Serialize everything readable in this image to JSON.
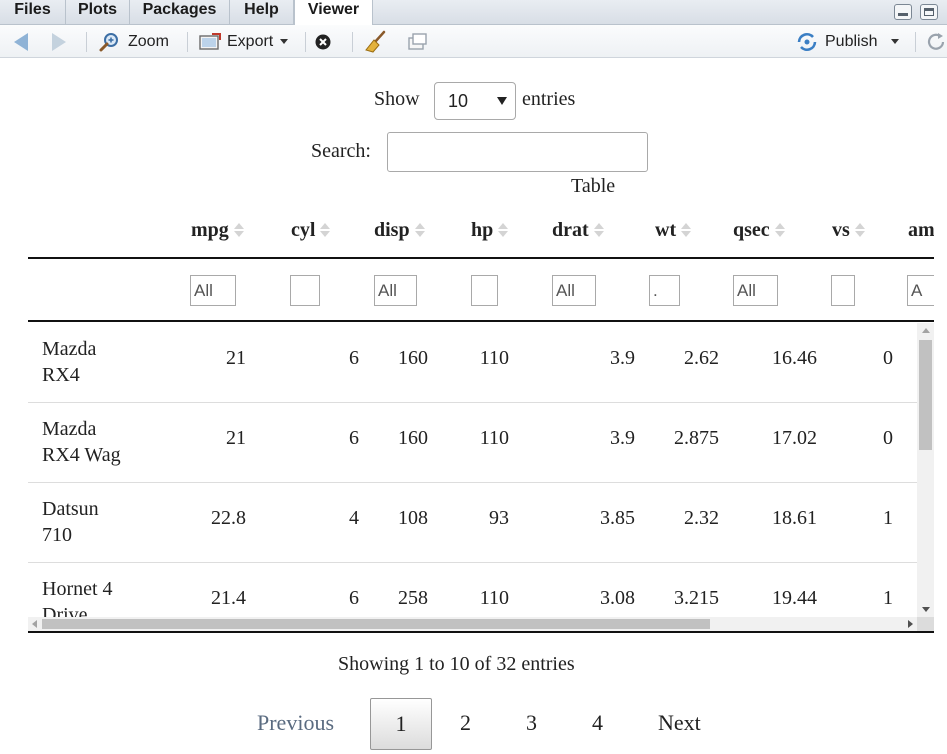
{
  "tabs": [
    {
      "label": "Files",
      "active": false
    },
    {
      "label": "Plots",
      "active": false
    },
    {
      "label": "Packages",
      "active": false
    },
    {
      "label": "Help",
      "active": false
    },
    {
      "label": "Viewer",
      "active": true
    }
  ],
  "toolbar": {
    "zoom_label": "Zoom",
    "export_label": "Export",
    "publish_label": "Publish"
  },
  "datatable": {
    "length_prefix": "Show",
    "length_value": "10",
    "length_suffix": "entries",
    "search_label": "Search:",
    "caption": "Table",
    "columns": [
      "mpg",
      "cyl",
      "disp",
      "hp",
      "drat",
      "wt",
      "qsec",
      "vs",
      "am"
    ],
    "filters": [
      "All",
      "",
      "All",
      "",
      "All",
      ".",
      "All",
      "",
      "A"
    ],
    "rows": [
      {
        "name": [
          "Mazda",
          "RX4"
        ],
        "values": [
          "21",
          "6",
          "160",
          "110",
          "3.9",
          "2.62",
          "16.46",
          "0"
        ]
      },
      {
        "name": [
          "Mazda",
          "RX4 Wag"
        ],
        "values": [
          "21",
          "6",
          "160",
          "110",
          "3.9",
          "2.875",
          "17.02",
          "0"
        ]
      },
      {
        "name": [
          "Datsun",
          "710"
        ],
        "values": [
          "22.8",
          "4",
          "108",
          "93",
          "3.85",
          "2.32",
          "18.61",
          "1"
        ]
      },
      {
        "name": [
          "Hornet 4",
          "Drive"
        ],
        "values": [
          "21.4",
          "6",
          "258",
          "110",
          "3.08",
          "3.215",
          "19.44",
          "1"
        ]
      }
    ],
    "info": "Showing 1 to 10 of 32 entries",
    "pager": {
      "previous": "Previous",
      "pages": [
        "1",
        "2",
        "3",
        "4"
      ],
      "current": "1",
      "next": "Next"
    }
  },
  "colors": {
    "link_disabled": "#5a6b80",
    "rule": "#111111",
    "sort_icon": "#d4d4d4"
  }
}
